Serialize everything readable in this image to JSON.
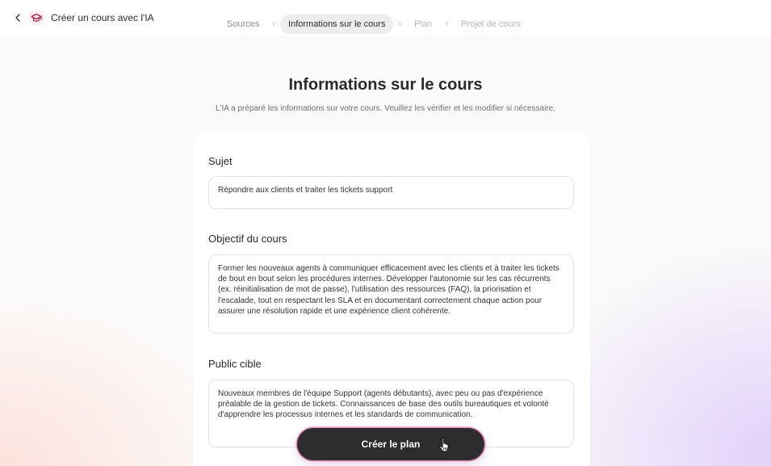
{
  "header": {
    "back_icon": "chevron-left-icon",
    "app_icon": "graduation-cap-icon",
    "title": "Créer un cours avec l'IA"
  },
  "steps": [
    {
      "label": "Sources",
      "state": "done"
    },
    {
      "label": "Informations sur le cours",
      "state": "active"
    },
    {
      "label": "Plan",
      "state": "future"
    },
    {
      "label": "Projet de cours",
      "state": "future"
    }
  ],
  "main": {
    "title": "Informations sur le cours",
    "subtitle": "L'IA a préparé les informations sur votre cours. Veuillez les vérifier et les modifier si nécessaire."
  },
  "form": {
    "subject": {
      "label": "Sujet",
      "value": "Répondre aux clients et traiter les tickets support"
    },
    "objective": {
      "label": "Objectif du cours",
      "value": "Former les nouveaux agents à communiquer efficacement avec les clients et à traiter les tickets de bout en bout selon les procédures internes. Développer l'autonomie sur les cas récurrents (ex. réinitialisation de mot de passe), l'utilisation des ressources (FAQ), la priorisation et l'escalade, tout en respectant les SLA et en documentant correctement chaque action pour assurer une résolution rapide et une expérience client cohérente."
    },
    "audience": {
      "label": "Public cible",
      "value": "Nouveaux membres de l'équipe Support (agents débutants), avec peu ou pas d'expérience préalable de la gestion de tickets. Connaissances de base des outils bureautiques et volonté d'apprendre les processus internes et les standards de communication."
    }
  },
  "cta": {
    "label": "Créer le plan"
  },
  "colors": {
    "accent_glow": "#e978aa",
    "button_bg": "#2d2d30",
    "active_step_bg": "#eeedec"
  }
}
